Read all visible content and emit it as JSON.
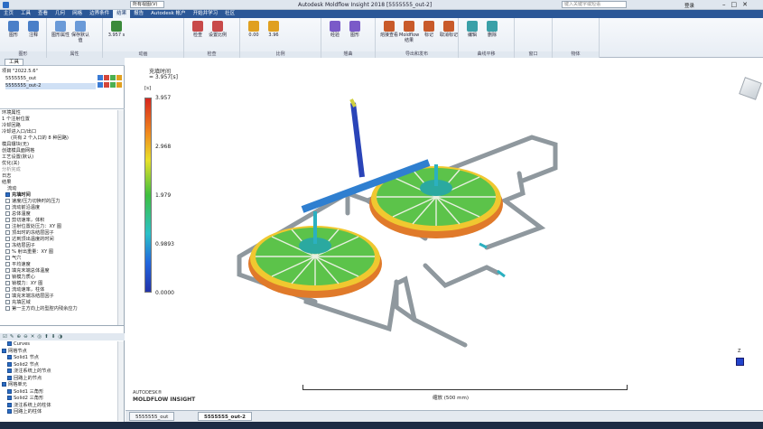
{
  "titlebar": {
    "left_tabs": [
      "主页",
      "工具",
      "查看",
      "几何",
      "网格",
      "边界条件",
      "结果",
      "报告"
    ],
    "title": "Autodesk Moldflow Insight 2018",
    "doc": "[5555555_out-2]",
    "search_placeholder": "键入关键字或短语",
    "user": "登录",
    "selected_view": "所有视图(V)"
  },
  "menubar": {
    "items": [
      "主页",
      "工具",
      "查看",
      "几何",
      "网格",
      "边界条件",
      "结果",
      "报告",
      "Autodesk 帐户",
      "开始并学习",
      "社区"
    ],
    "active": "结果"
  },
  "ribbon": {
    "groups": [
      {
        "label": "图形",
        "buttons": [
          "图形",
          "注释"
        ]
      },
      {
        "label": "属性",
        "buttons": [
          "图形属性",
          "保存默认值"
        ]
      },
      {
        "label": "动画",
        "buttons": [
          "3.957 s"
        ]
      },
      {
        "label": "检查",
        "buttons": [
          "检查",
          "设置比例"
        ]
      },
      {
        "label": "比例",
        "buttons": [
          "0.00",
          "3.96"
        ]
      },
      {
        "label": "翘曲",
        "buttons": [
          "经验",
          "图形"
        ]
      },
      {
        "label": "导出和发布",
        "buttons": [
          "熔接查看",
          "Moldflow 结果",
          "标记",
          "取消标记"
        ]
      },
      {
        "label": "曲线平移",
        "buttons": [
          "编辑",
          "删除"
        ]
      },
      {
        "label": "窗口",
        "buttons": []
      },
      {
        "label": "物体",
        "buttons": []
      }
    ]
  },
  "left_panel": {
    "tabs": [
      "工具"
    ],
    "project_name": "项目 \"2022.5.6\"",
    "studies": [
      "5555555_out",
      "5555555_out-2"
    ],
    "tasks": [
      "环境属性",
      "1 个注射位置",
      "冷却回路",
      "冷却进入口/出口",
      "(共有 2 个入口的 8 种回路)",
      "模具镶块(无)",
      "创建模具面网格",
      "工艺设置(默认)",
      "优化(关)",
      "分析完成",
      "日志",
      "结果"
    ],
    "results_root": "流动",
    "results": [
      {
        "label": "充填时间",
        "checked": true
      },
      {
        "label": "速度/压力切换时的压力",
        "checked": false
      },
      {
        "label": "流动前沿温度",
        "checked": false
      },
      {
        "label": "总体温度",
        "checked": false
      },
      {
        "label": "剪切速率，体积",
        "checked": false
      },
      {
        "label": "注射位置处压力：XY 图",
        "checked": false
      },
      {
        "label": "顶出时的冻结层因子",
        "checked": false
      },
      {
        "label": "达到顶出温度的时间",
        "checked": false
      },
      {
        "label": "冻结层因子",
        "checked": false
      },
      {
        "label": "% 射出重量：XY 图",
        "checked": false
      },
      {
        "label": "气穴",
        "checked": false
      },
      {
        "label": "平均速度",
        "checked": false
      },
      {
        "label": "填充末端总体温度",
        "checked": false
      },
      {
        "label": "锁模力质心",
        "checked": false
      },
      {
        "label": "锁模力：XY 图",
        "checked": false
      },
      {
        "label": "流动速率，柱体",
        "checked": false
      },
      {
        "label": "填充末端冻结层因子",
        "checked": false
      },
      {
        "label": "充填区域",
        "checked": false
      },
      {
        "label": "第一主方向上的型腔内残余应力",
        "checked": false
      }
    ],
    "layers": [
      {
        "label": "Curves",
        "checked": true
      },
      {
        "label": "网格节点",
        "checked": true
      },
      {
        "label": "Solid1 节点",
        "checked": true
      },
      {
        "label": "Solid2 节点",
        "checked": true
      },
      {
        "label": "浇注系统上的节点",
        "checked": true
      },
      {
        "label": "回路上的节点",
        "checked": true
      },
      {
        "label": "网格单元",
        "checked": true
      },
      {
        "label": "Solid1 三角形",
        "checked": true
      },
      {
        "label": "Solid2 三角形",
        "checked": true
      },
      {
        "label": "浇注系统上的柱体",
        "checked": true
      },
      {
        "label": "回路上的柱体",
        "checked": true
      }
    ]
  },
  "viewport": {
    "result_title": "充填时间",
    "result_value": "= 3.957[s]",
    "unit": "[s]",
    "legend": [
      "3.957",
      "2.968",
      "1.979",
      "0.9893",
      "0.0000"
    ],
    "scale_label": "缩放 (500 mm)",
    "brand_line1": "AUTODESK®",
    "brand_line2": "MOLDFLOW INSIGHT",
    "colors": {
      "max": "#d7261e",
      "mid": "#3fbf3f",
      "min": "#2233aa",
      "pipe": "#9aa3a9"
    }
  },
  "statusbar": {
    "tabs": [
      "5555555_out",
      "5555555_out-2"
    ]
  }
}
